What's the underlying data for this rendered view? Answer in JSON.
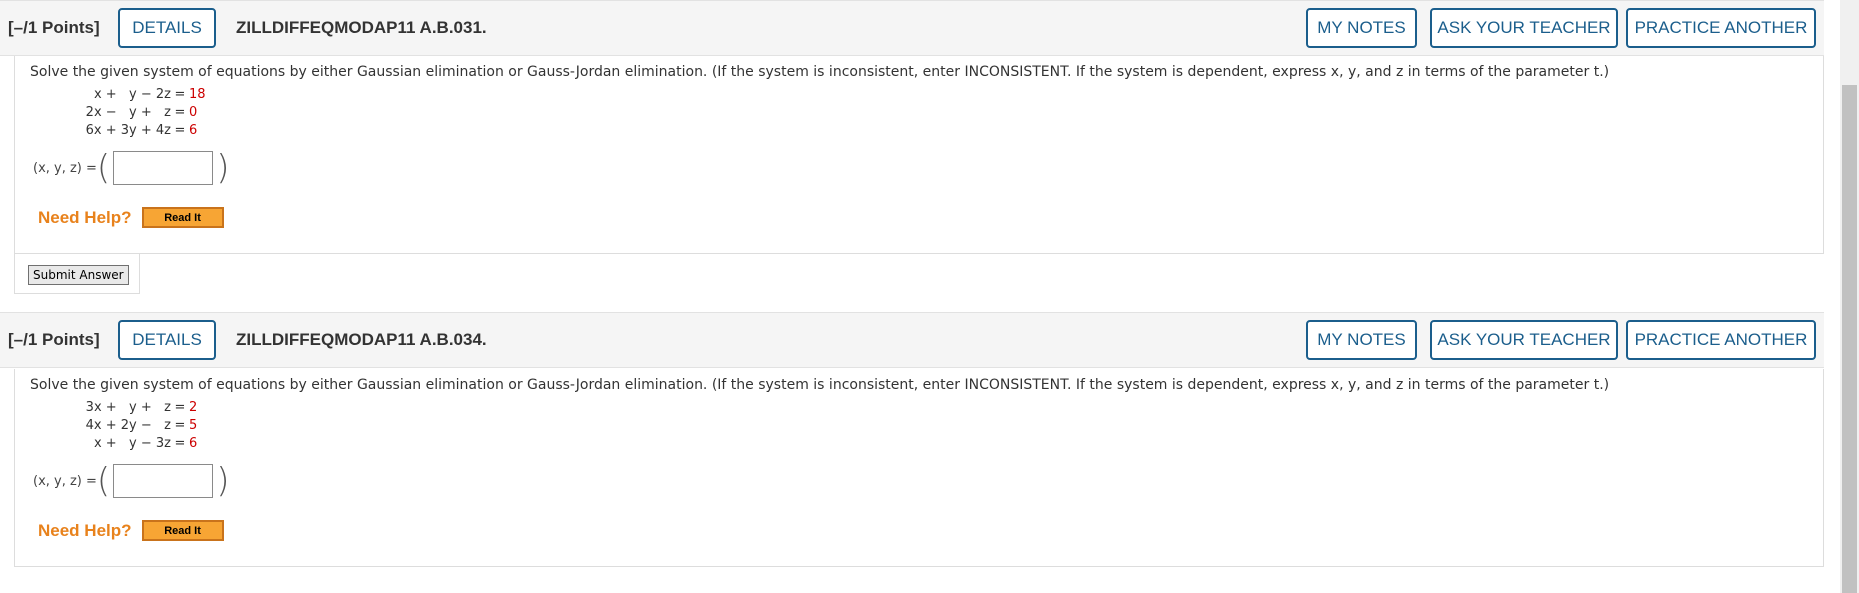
{
  "questions": [
    {
      "points": "[–/1 Points]",
      "details_label": "DETAILS",
      "code": "ZILLDIFFEQMODAP11 A.B.031.",
      "my_notes_label": "MY NOTES",
      "ask_label": "ASK YOUR TEACHER",
      "practice_label": "PRACTICE ANOTHER",
      "prompt": "Solve the given system of equations by either Gaussian elimination or Gauss-Jordan elimination. (If the system is inconsistent, enter INCONSISTENT. If the system is dependent, express  x, y, and z  in terms of the parameter t.)",
      "equations": [
        {
          "lhs": "x +   y − 2z",
          "sep": "=",
          "rhs": "18"
        },
        {
          "lhs": "2x −   y +   z",
          "sep": "=",
          "rhs": "0"
        },
        {
          "lhs": "6x + 3y + 4z",
          "sep": "=",
          "rhs": "6"
        }
      ],
      "answer_label": "(x, y, z) =",
      "answer_value": "",
      "help_label": "Need Help?",
      "read_it_label": "Read It",
      "submit_label": "Submit Answer"
    },
    {
      "points": "[–/1 Points]",
      "details_label": "DETAILS",
      "code": "ZILLDIFFEQMODAP11 A.B.034.",
      "my_notes_label": "MY NOTES",
      "ask_label": "ASK YOUR TEACHER",
      "practice_label": "PRACTICE ANOTHER",
      "prompt": "Solve the given system of equations by either Gaussian elimination or Gauss-Jordan elimination. (If the system is inconsistent, enter INCONSISTENT. If the system is dependent, express  x, y, and z  in terms of the parameter t.)",
      "equations": [
        {
          "lhs": "3x +   y +   z",
          "sep": "=",
          "rhs": "2"
        },
        {
          "lhs": "4x + 2y −   z",
          "sep": "=",
          "rhs": "5"
        },
        {
          "lhs": "x +   y − 3z",
          "sep": "=",
          "rhs": "6"
        }
      ],
      "answer_label": "(x, y, z) =",
      "answer_value": "",
      "help_label": "Need Help?",
      "read_it_label": "Read It"
    }
  ],
  "colors": {
    "button_blue": "#1b5e8c",
    "help_orange": "#e8821c",
    "rhs_red": "#cc0000"
  }
}
